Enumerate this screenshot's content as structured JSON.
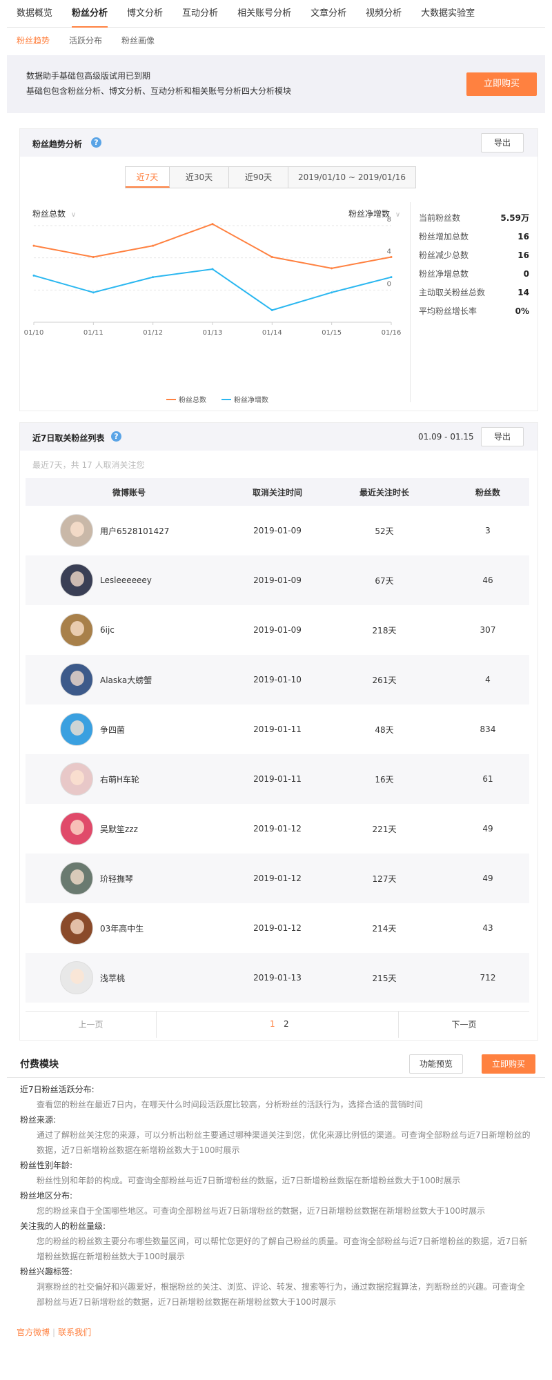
{
  "top_nav": [
    "数据概览",
    "粉丝分析",
    "博文分析",
    "互动分析",
    "相关账号分析",
    "文章分析",
    "视频分析",
    "大数据实验室"
  ],
  "top_nav_active": 1,
  "sub_nav": [
    "粉丝趋势",
    "活跃分布",
    "粉丝画像"
  ],
  "sub_nav_active": 0,
  "notice": {
    "line1": "数据助手基础包高级版试用已到期",
    "line2": "基础包包含粉丝分析、博文分析、互动分析和相关账号分析四大分析模块",
    "buy": "立即购买"
  },
  "trend": {
    "title": "粉丝趋势分析",
    "help": "?",
    "export": "导出",
    "ranges": [
      "近7天",
      "近30天",
      "近90天",
      "2019/01/10 ~ 2019/01/16"
    ],
    "active_range": 0,
    "left_select": "粉丝总数",
    "right_select": "粉丝净增数",
    "stats": [
      {
        "label": "当前粉丝数",
        "value": "5.59万"
      },
      {
        "label": "粉丝增加总数",
        "value": "16"
      },
      {
        "label": "粉丝减少总数",
        "value": "16"
      },
      {
        "label": "粉丝净增总数",
        "value": "0"
      },
      {
        "label": "主动取关粉丝总数",
        "value": "14"
      },
      {
        "label": "平均粉丝增长率",
        "value": "0%"
      }
    ]
  },
  "chart_data": {
    "type": "line",
    "x": [
      "01/10",
      "01/11",
      "01/12",
      "01/13",
      "01/14",
      "01/15",
      "01/16"
    ],
    "right_ticks": [
      "8",
      "4",
      "0"
    ],
    "y_right_range": [
      -4,
      8
    ],
    "series": [
      {
        "name": "粉丝总数",
        "color": "#ff8140",
        "values": [
          5.5,
          4.1,
          5.5,
          8.2,
          4.1,
          2.7,
          4.1
        ]
      },
      {
        "name": "粉丝净增数",
        "color": "#2bb7f0",
        "values": [
          1.8,
          -0.3,
          1.6,
          2.6,
          -2.5,
          -0.3,
          1.6
        ]
      }
    ],
    "title": "",
    "xlabel": "",
    "ylabel": "",
    "grid": true,
    "legend": "bottom"
  },
  "unfollow": {
    "title": "近7日取关粉丝列表",
    "help": "?",
    "date_range": "01.09 - 01.15",
    "export": "导出",
    "summary": "最近7天，共 17 人取消关注您",
    "columns": [
      "微博账号",
      "取消关注时间",
      "最近关注时长",
      "粉丝数"
    ],
    "rows": [
      {
        "name": "用户6528101427",
        "time": "2019-01-09",
        "duration": "52天",
        "fans": "3",
        "color": "#c9b8a8"
      },
      {
        "name": "Lesleeeeeey",
        "time": "2019-01-09",
        "duration": "67天",
        "fans": "46",
        "color": "#3a3f55"
      },
      {
        "name": "6ijc",
        "time": "2019-01-09",
        "duration": "218天",
        "fans": "307",
        "color": "#a8804a"
      },
      {
        "name": "Alaska大螃蟹",
        "time": "2019-01-10",
        "duration": "261天",
        "fans": "4",
        "color": "#3d5a8a"
      },
      {
        "name": "争四菌",
        "time": "2019-01-11",
        "duration": "48天",
        "fans": "834",
        "color": "#3aa0e0"
      },
      {
        "name": "右萌H车轮",
        "time": "2019-01-11",
        "duration": "16天",
        "fans": "61",
        "color": "#e8c8c8"
      },
      {
        "name": "吴默笙zzz",
        "time": "2019-01-12",
        "duration": "221天",
        "fans": "49",
        "color": "#e04a6a"
      },
      {
        "name": "玠轻撫琴",
        "time": "2019-01-12",
        "duration": "127天",
        "fans": "49",
        "color": "#6a7a70"
      },
      {
        "name": "03年高中生",
        "time": "2019-01-12",
        "duration": "214天",
        "fans": "43",
        "color": "#8a4a2a"
      },
      {
        "name": "浅萃桃",
        "time": "2019-01-13",
        "duration": "215天",
        "fans": "712",
        "color": "#e8e8e8"
      }
    ],
    "prev": "上一页",
    "next": "下一页",
    "pages": [
      "1",
      "2"
    ]
  },
  "paid": {
    "title": "付费模块",
    "preview": "功能预览",
    "buy": "立即购买",
    "items": [
      {
        "h": "近7日粉丝活跃分布:",
        "b": "查看您的粉丝在最近7日内，在哪天什么时间段活跃度比较高，分析粉丝的活跃行为，选择合适的营销时间"
      },
      {
        "h": "粉丝来源:",
        "b": "通过了解粉丝关注您的来源，可以分析出粉丝主要通过哪种渠道关注到您，优化来源比例低的渠道。可查询全部粉丝与近7日新增粉丝的数据，近7日新增粉丝数据在新增粉丝数大于100时展示"
      },
      {
        "h": "粉丝性别年龄:",
        "b": "粉丝性别和年龄的构成。可查询全部粉丝与近7日新增粉丝的数据，近7日新增粉丝数据在新增粉丝数大于100时展示"
      },
      {
        "h": "粉丝地区分布:",
        "b": "您的粉丝来自于全国哪些地区。可查询全部粉丝与近7日新增粉丝的数据，近7日新增粉丝数据在新增粉丝数大于100时展示"
      },
      {
        "h": "关注我的人的粉丝量级:",
        "b": "您的粉丝的粉丝数主要分布哪些数量区间，可以帮忙您更好的了解自己粉丝的质量。可查询全部粉丝与近7日新增粉丝的数据，近7日新增粉丝数据在新增粉丝数大于100时展示"
      },
      {
        "h": "粉丝兴趣标签:",
        "b": "洞察粉丝的社交偏好和兴趣爱好，根据粉丝的关注、浏览、评论、转发、搜索等行为，通过数据挖掘算法，判断粉丝的兴趣。可查询全部粉丝与近7日新增粉丝的数据，近7日新增粉丝数据在新增粉丝数大于100时展示"
      }
    ]
  },
  "footer": {
    "link1": "官方微博",
    "link2": "联系我们"
  }
}
